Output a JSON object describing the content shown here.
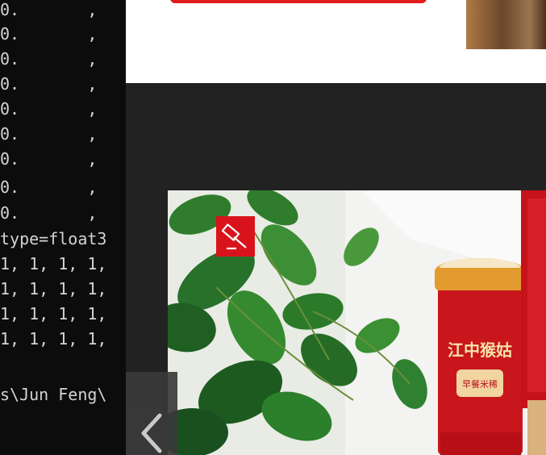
{
  "terminal": {
    "lines": [
      "0.       ,",
      "0.       ,",
      "0.       ,",
      "0.       ,",
      "0.       ,",
      "0.       ,",
      "0.       ,",
      "0.       ,",
      "0.       ,",
      "type=float3",
      "1, 1, 1, 1,",
      "1, 1, 1, 1,",
      "1, 1, 1, 1,",
      "1, 1, 1, 1,",
      "",
      "s\\Jun Feng\\"
    ]
  },
  "browser": {
    "photo": {
      "cup_brand_text": "江中猴姑",
      "cup_sub_text": "早餐米稀"
    },
    "badge_icon": "gavel-icon",
    "prev_icon": "chevron-left-icon",
    "colors": {
      "accent_red": "#d9131b",
      "panel_dark": "#222222"
    }
  }
}
